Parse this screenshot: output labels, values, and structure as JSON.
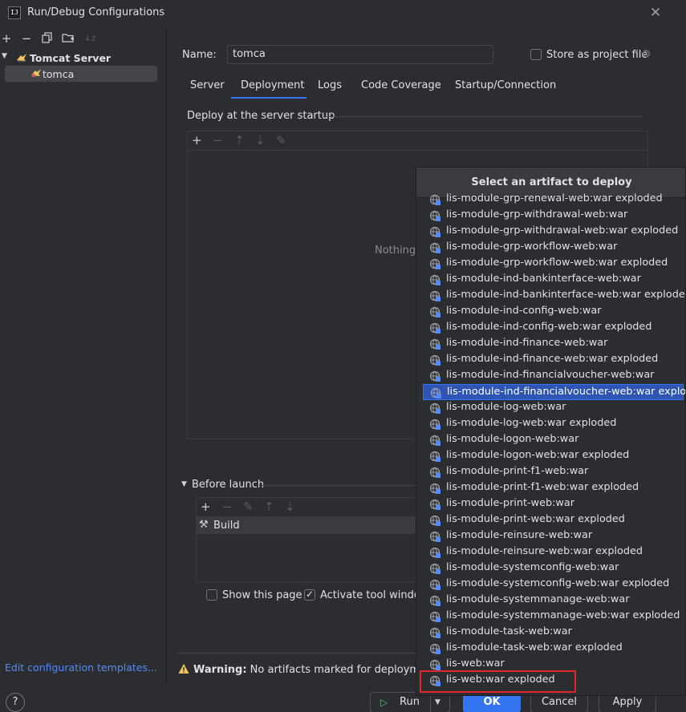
{
  "window": {
    "title": "Run/Debug Configurations",
    "app_icon_text": "IJ"
  },
  "sidebar": {
    "tree": {
      "group_label": "Tomcat Server",
      "child_label": "tomca"
    },
    "edit_templates_link": "Edit configuration templates..."
  },
  "form": {
    "name_label": "Name:",
    "name_value": "tomca",
    "store_label": "Store as project file",
    "store_checked": false
  },
  "tabs": [
    {
      "label": "Server",
      "active": false
    },
    {
      "label": "Deployment",
      "active": true
    },
    {
      "label": "Logs",
      "active": false
    },
    {
      "label": "Code Coverage",
      "active": false
    },
    {
      "label": "Startup/Connection",
      "active": false
    }
  ],
  "deployment": {
    "section_title": "Deploy at the server startup",
    "empty_text": "Nothing"
  },
  "before_launch": {
    "title": "Before launch",
    "build_label": "Build",
    "show_page_label": "Show this page",
    "show_page_checked": false,
    "activate_label": "Activate tool window",
    "activate_checked": true
  },
  "warning": {
    "bold": "Warning:",
    "text": "No artifacts marked for deployment"
  },
  "buttons": {
    "help": "?",
    "run": "Run",
    "ok": "OK",
    "cancel": "Cancel",
    "apply": "Apply"
  },
  "popup": {
    "title": "Select an artifact to deploy",
    "selected_index": 12,
    "highlighted_index": 30,
    "items": [
      "lis-module-grp-renewal-web:war exploded",
      "lis-module-grp-withdrawal-web:war",
      "lis-module-grp-withdrawal-web:war exploded",
      "lis-module-grp-workflow-web:war",
      "lis-module-grp-workflow-web:war exploded",
      "lis-module-ind-bankinterface-web:war",
      "lis-module-ind-bankinterface-web:war exploded",
      "lis-module-ind-config-web:war",
      "lis-module-ind-config-web:war exploded",
      "lis-module-ind-finance-web:war",
      "lis-module-ind-finance-web:war exploded",
      "lis-module-ind-financialvoucher-web:war",
      "lis-module-ind-financialvoucher-web:war exploded",
      "lis-module-log-web:war",
      "lis-module-log-web:war exploded",
      "lis-module-logon-web:war",
      "lis-module-logon-web:war exploded",
      "lis-module-print-f1-web:war",
      "lis-module-print-f1-web:war exploded",
      "lis-module-print-web:war",
      "lis-module-print-web:war exploded",
      "lis-module-reinsure-web:war",
      "lis-module-reinsure-web:war exploded",
      "lis-module-systemconfig-web:war",
      "lis-module-systemconfig-web:war exploded",
      "lis-module-systemmanage-web:war",
      "lis-module-systemmanage-web:war exploded",
      "lis-module-task-web:war",
      "lis-module-task-web:war exploded",
      "lis-web:war",
      "lis-web:war exploded"
    ]
  },
  "colors": {
    "accent": "#3574f0",
    "background": "#2b2d30",
    "highlight_box": "#e0262d",
    "warning": "#f2c55c",
    "link": "#548af7"
  }
}
